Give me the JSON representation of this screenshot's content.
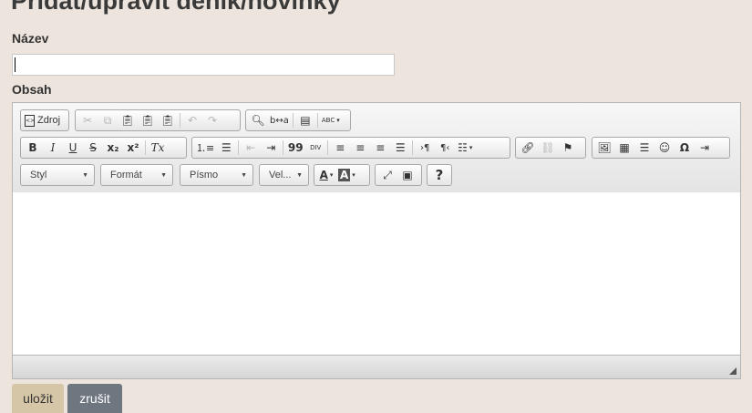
{
  "page": {
    "title": "Přidat/upravit deník/novinky"
  },
  "form": {
    "name_label": "Název",
    "name_value": "",
    "content_label": "Obsah"
  },
  "toolbar": {
    "source_label": "Zdroj",
    "combos": {
      "style": "Styl",
      "format": "Formát",
      "font": "Písmo",
      "size": "Vel..."
    },
    "help_label": "?",
    "bold": "B",
    "italic": "I",
    "underline": "U",
    "strike": "S",
    "subscript": "x₂",
    "superscript": "x²",
    "remove_format": "Tx",
    "blockquote": "99",
    "special_char": "Ω",
    "text_color": "A",
    "bg_color": "A",
    "spell": "ABC"
  },
  "buttons": {
    "save": "uložit",
    "cancel": "zrušit"
  },
  "colors": {
    "background": "#ede4dd",
    "save_button": "#d6c6a8",
    "cancel_button": "#6e7780"
  }
}
